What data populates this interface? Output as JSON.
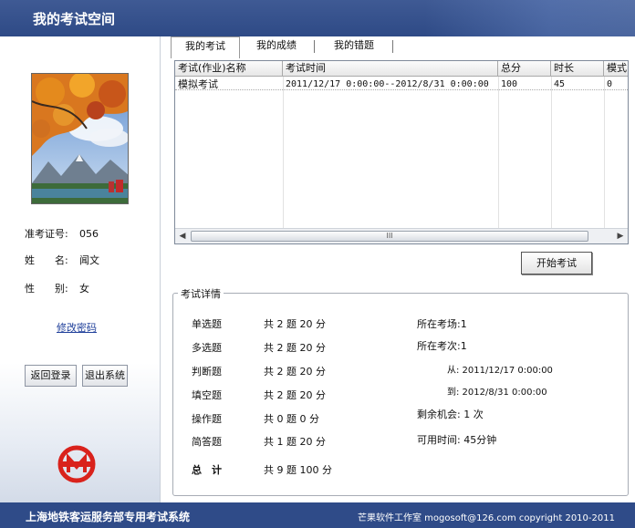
{
  "window": {
    "title": "我的考试空间"
  },
  "tabs": [
    "我的考试",
    "我的成绩",
    "我的错题"
  ],
  "profile": {
    "exam_id_label": "准考证号:",
    "exam_id": "056",
    "name_label": "姓　　名:",
    "name": "闻文",
    "gender_label": "性　　别:",
    "gender": "女",
    "change_password": "修改密码",
    "back_login": "返回登录",
    "exit_system": "退出系统",
    "logo_icon": "metro-logo-icon"
  },
  "grid": {
    "columns": [
      "考试(作业)名称",
      "考试时间",
      "总分",
      "时长",
      "模式"
    ],
    "rows": [
      [
        "模拟考试",
        "2011/12/17 0:00:00--2012/8/31 0:00:00",
        "100",
        "45",
        "0"
      ]
    ],
    "scroll_grip": "III"
  },
  "start_button": "开始考试",
  "details": {
    "legend": "考试详情",
    "items": [
      {
        "type": "单选题",
        "summary": "共 2 题  20 分"
      },
      {
        "type": "多选题",
        "summary": "共 2 题  20 分"
      },
      {
        "type": "判断题",
        "summary": "共 2 题  20 分"
      },
      {
        "type": "填空题",
        "summary": "共 2 题  20 分"
      },
      {
        "type": "操作题",
        "summary": "共 0 题 0 分"
      },
      {
        "type": "简答题",
        "summary": "共 1 题  20 分"
      }
    ],
    "total_label": "总　计",
    "total": "共 9 题  100 分",
    "room": "所在考场:1",
    "session": "所在考次:1",
    "from": "从: 2011/12/17 0:00:00",
    "to": "到: 2012/8/31 0:00:00",
    "chances": "剩余机会: 1 次",
    "time_avail": "可用时间: 45分钟"
  },
  "footer": {
    "system_name": "上海地铁客运服务部专用考试系统",
    "copyright": "芒果软件工作室  mogosoft@126.com  copyright 2010-2011"
  },
  "colors": {
    "header": "#2e4a86",
    "footer": "#2f4b88",
    "logo_red": "#d9221c",
    "link": "#1f3f9a"
  }
}
